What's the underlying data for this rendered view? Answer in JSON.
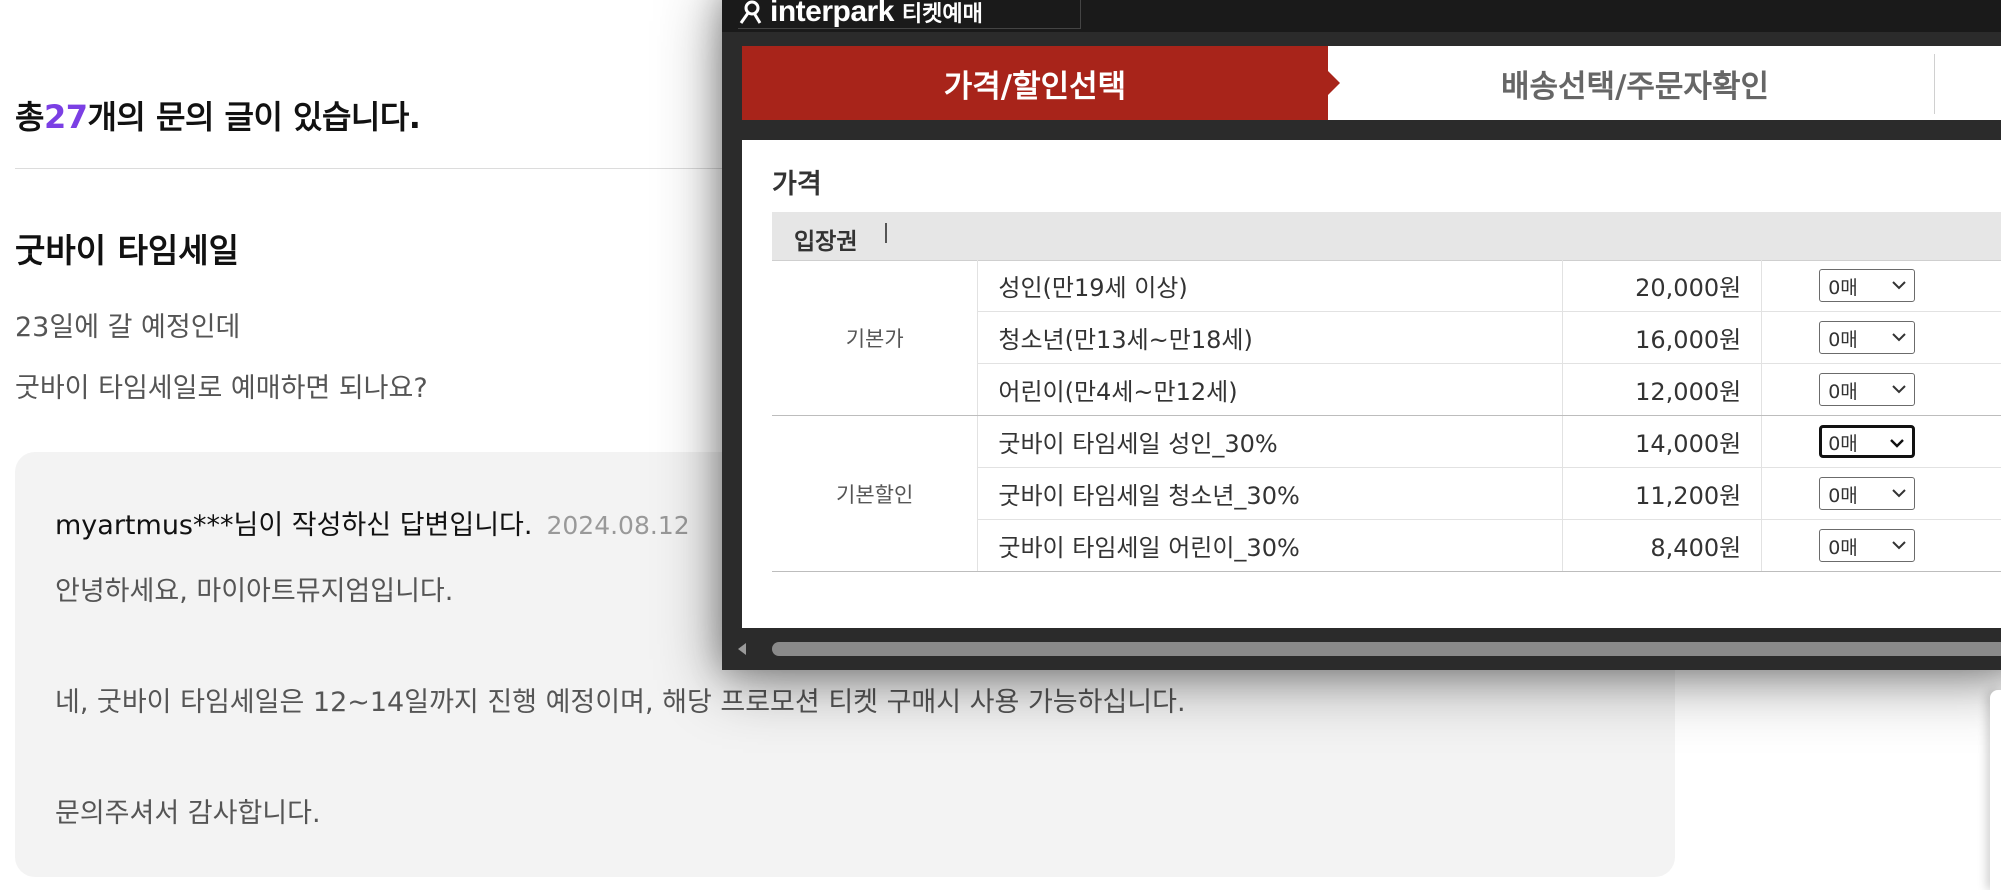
{
  "qna": {
    "count_prefix": "총",
    "count_number": "27",
    "count_suffix": "개의 문의 글이 있습니다.",
    "question_title": "굿바이 타임세일",
    "question_lines": [
      "23일에 갈 예정인데",
      "굿바이 타임세일로 예매하면 되나요?"
    ],
    "answer_author_text": "myartmus***님이 작성하신 답변입니다.",
    "answer_date": "2024.08.12",
    "answer_lines": [
      "안녕하세요, 마이아트뮤지엄입니다.",
      "네, 굿바이 타임세일은 12~14일까지 진행 예정이며, 해당 프로모션 티켓 구매시 사용 가능하십니다.",
      "문의주셔서 감사합니다."
    ],
    "accent_color": "#7b3fe4"
  },
  "popup": {
    "logo_text": "interpark",
    "logo_sub": "티켓예매",
    "tabs": {
      "active": "가격/할인선택",
      "next": "배송선택/주문자확인"
    },
    "active_tab_color": "#a8241a",
    "price_title": "가격",
    "section_label": "입장권",
    "groups": [
      {
        "category": "기본가",
        "rows": [
          {
            "name": "성인(만19세 이상)",
            "price": "20,000원",
            "qty": "0매"
          },
          {
            "name": "청소년(만13세~만18세)",
            "price": "16,000원",
            "qty": "0매"
          },
          {
            "name": "어린이(만4세~만12세)",
            "price": "12,000원",
            "qty": "0매"
          }
        ]
      },
      {
        "category": "기본할인",
        "rows": [
          {
            "name": "굿바이 타임세일 성인_30%",
            "price": "14,000원",
            "qty": "0매"
          },
          {
            "name": "굿바이 타임세일 청소년_30%",
            "price": "11,200원",
            "qty": "0매"
          },
          {
            "name": "굿바이 타임세일 어린이_30%",
            "price": "8,400원",
            "qty": "0매"
          }
        ]
      }
    ]
  }
}
